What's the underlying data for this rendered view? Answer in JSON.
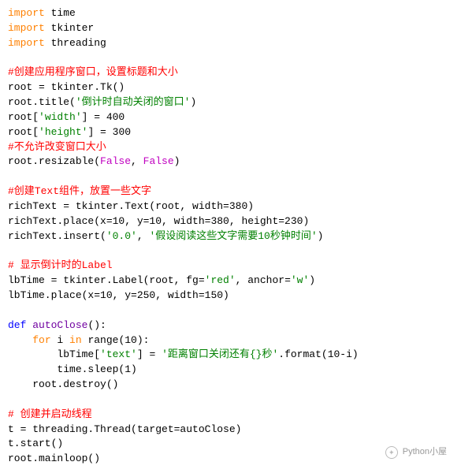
{
  "code": {
    "l01a": "import",
    "l01b": " time",
    "l02a": "import",
    "l02b": " tkinter",
    "l03a": "import",
    "l03b": " threading",
    "l05": "#创建应用程序窗口，设置标题和大小",
    "l06": "root = tkinter.Tk()",
    "l07a": "root.title(",
    "l07b": "'倒计时自动关闭的窗口'",
    "l07c": ")",
    "l08a": "root[",
    "l08b": "'width'",
    "l08c": "] = 400",
    "l09a": "root[",
    "l09b": "'height'",
    "l09c": "] = 300",
    "l10": "#不允许改变窗口大小",
    "l11a": "root.resizable(",
    "l11b": "False",
    "l11c": ", ",
    "l11d": "False",
    "l11e": ")",
    "l13": "#创建Text组件，放置一些文字",
    "l14": "richText = tkinter.Text(root, width=380)",
    "l15": "richText.place(x=10, y=10, width=380, height=230)",
    "l16a": "richText.insert(",
    "l16b": "'0.0'",
    "l16c": ", ",
    "l16d": "'假设阅读这些文字需要10秒钟时间'",
    "l16e": ")",
    "l18": "# 显示倒计时的Label",
    "l19a": "lbTime = tkinter.Label(root, fg=",
    "l19b": "'red'",
    "l19c": ", anchor=",
    "l19d": "'w'",
    "l19e": ")",
    "l20": "lbTime.place(x=10, y=250, width=150)",
    "l22a": "def",
    "l22b": " ",
    "l22c": "autoClose",
    "l22d": "():",
    "l23a": "    ",
    "l23b": "for",
    "l23c": " i ",
    "l23d": "in",
    "l23e": " range(10):",
    "l24a": "        lbTime[",
    "l24b": "'text'",
    "l24c": "] = ",
    "l24d": "'距离窗口关闭还有{}秒'",
    "l24e": ".format(10-i)",
    "l25": "        time.sleep(1)",
    "l26": "    root.destroy()",
    "l28": "# 创建并启动线程",
    "l29": "t = threading.Thread(target=autoClose)",
    "l30": "t.start()",
    "l31": "root.mainloop()"
  },
  "watermark": "Python小屋"
}
